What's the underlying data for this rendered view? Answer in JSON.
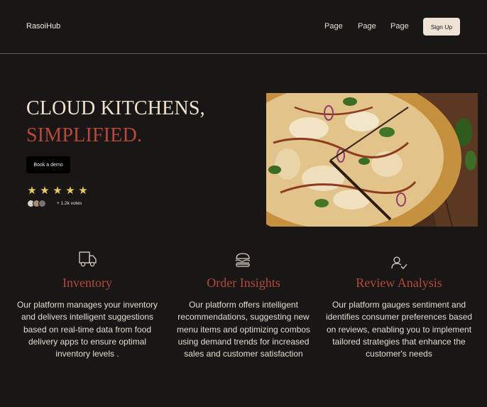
{
  "header": {
    "brand": "RasoiHub",
    "nav": [
      "Page",
      "Page",
      "Page"
    ],
    "signup_label": "Sign Up"
  },
  "hero": {
    "title_line1": "CLOUD KITCHENS,",
    "title_line2": "SIMPLIFIED.",
    "cta_label": "Book a demo",
    "rating_stars": 5,
    "votes": "+ 1.2k votes"
  },
  "features": [
    {
      "icon": "truck-icon",
      "title": "Inventory",
      "description": "Our platform manages your inventory and delivers intelligent suggestions based on real-time data from food delivery apps to ensure optimal inventory levels ."
    },
    {
      "icon": "burger-icon",
      "title": "Order Insights",
      "description": "Our platform offers intelligent recommendations, suggesting new menu items and optimizing combos using demand trends for increased sales and customer satisfaction"
    },
    {
      "icon": "user-check-icon",
      "title": "Review Analysis",
      "description": "Our platform gauges sentiment and identifies consumer preferences based on reviews, enabling you to implement tailored strategies that enhance the customer's needs"
    }
  ],
  "colors": {
    "background": "#181716",
    "accent": "#b9473a",
    "cream": "#efe3cf",
    "star": "#eacb5b"
  }
}
